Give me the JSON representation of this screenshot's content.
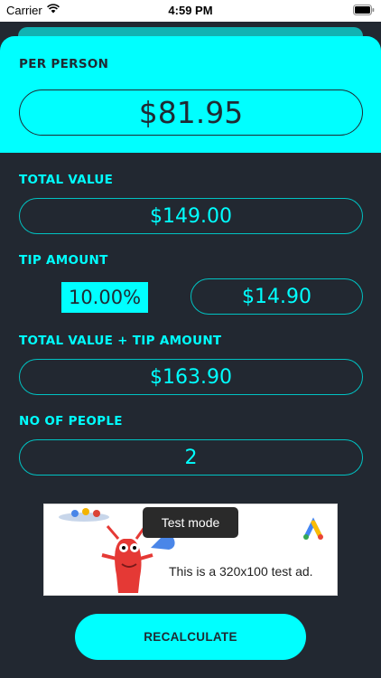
{
  "status_bar": {
    "carrier": "Carrier",
    "time": "4:59 PM"
  },
  "per_person": {
    "label": "PER PERSON",
    "value": "$81.95"
  },
  "total_value": {
    "label": "TOTAL VALUE",
    "value": "$149.00"
  },
  "tip_amount": {
    "label": "TIP AMOUNT",
    "percent": "10.00%",
    "value": "$14.90"
  },
  "total_with_tip": {
    "label": "TOTAL VALUE + TIP AMOUNT",
    "value": "$163.90"
  },
  "people": {
    "label": "NO OF PEOPLE",
    "value": "2"
  },
  "ad": {
    "badge": "Test mode",
    "text": "This is a 320x100 test ad."
  },
  "recalculate_label": "RECALCULATE",
  "colors": {
    "accent": "#00ffff",
    "background": "#222831",
    "dark_text": "#1f2a33"
  }
}
